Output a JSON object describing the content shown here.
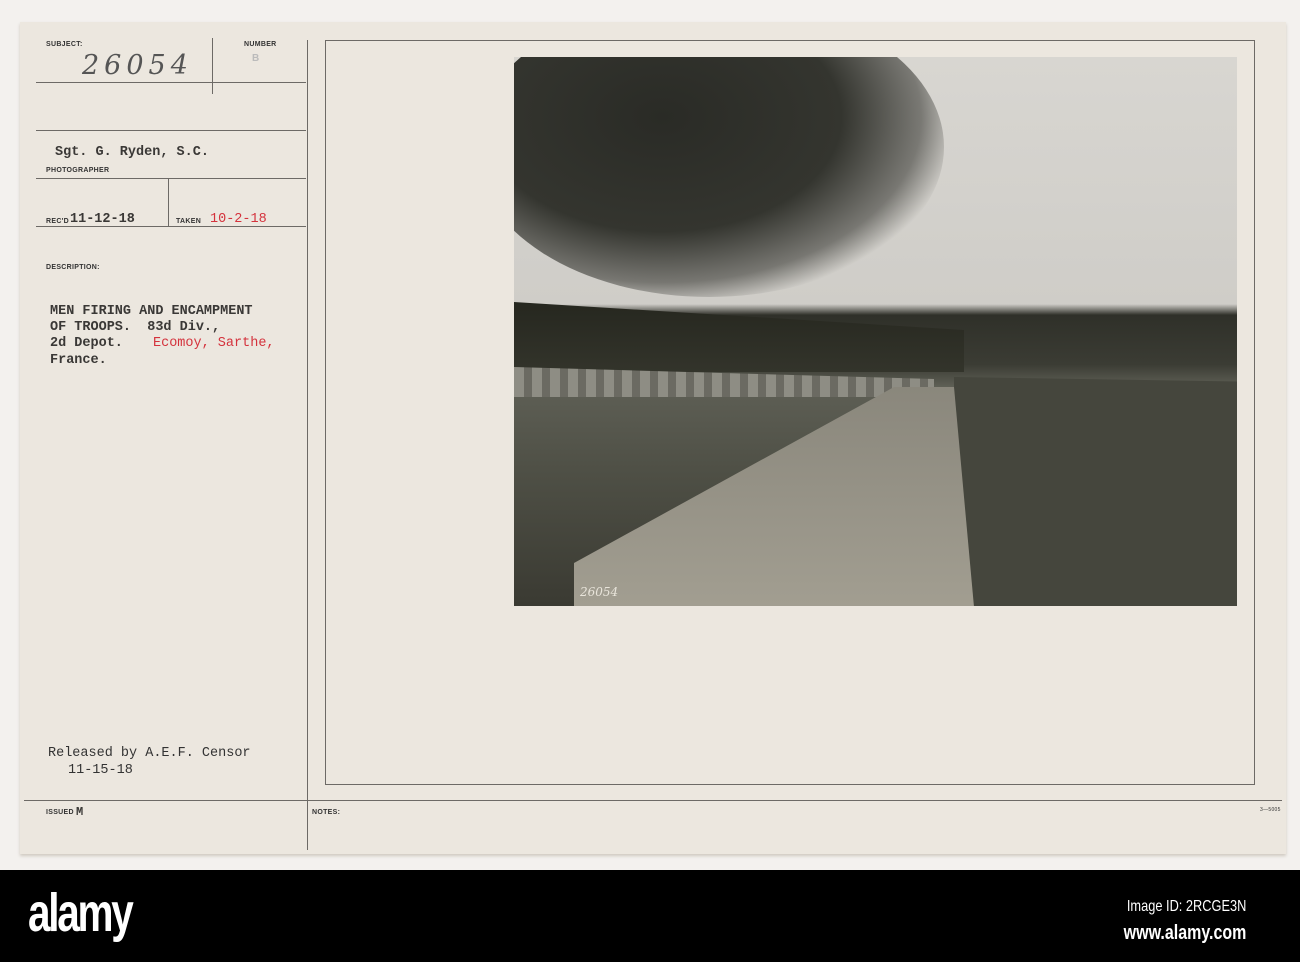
{
  "card": {
    "subject_label": "SUBJECT:",
    "subject_number": "26054",
    "number_label": "NUMBER",
    "number_stamp": "B",
    "photographer": "Sgt. G. Ryden, S.C.",
    "photographer_label": "PHOTOGRAPHER",
    "received_label": "REC'D",
    "received_date": "11-12-18",
    "taken_label": "TAKEN",
    "taken_date": "10-2-18",
    "description_label": "DESCRIPTION:",
    "description_lines": [
      "MEN FIRING AND ENCAMPMENT",
      "OF TROOPS.  83d Div.,",
      "2d Depot."
    ],
    "location_red": "Ecomoy, Sarthe,",
    "description_last": "France.",
    "release_line": "Released by A.E.F. Censor",
    "release_date": "11-15-18",
    "issued_label": "ISSUED",
    "issued_mark": "M",
    "notes_label": "NOTES:",
    "form_number": "3—5005",
    "photo_caption": "26054"
  },
  "footer": {
    "logo": "alamy",
    "image_id": "Image ID: 2RCGE3N",
    "site": "www.alamy.com"
  }
}
